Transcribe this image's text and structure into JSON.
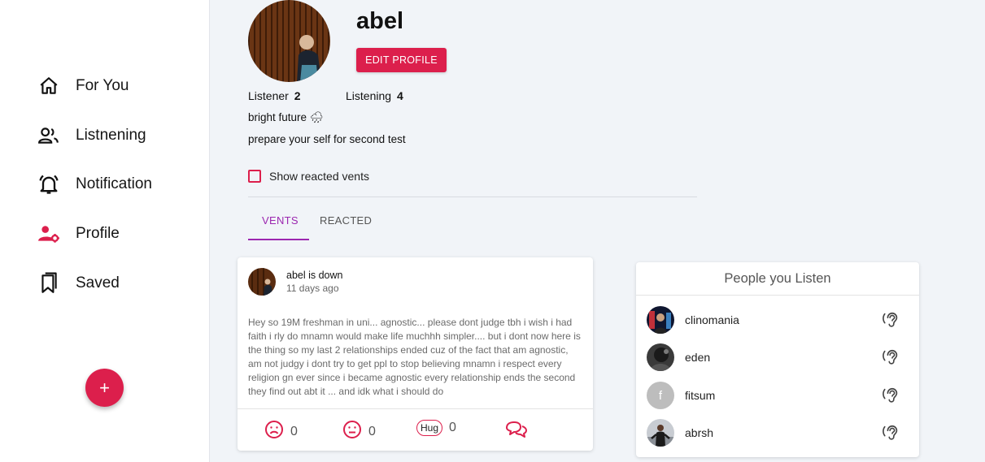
{
  "sidebar": {
    "items": [
      {
        "label": "For You",
        "icon": "home-icon"
      },
      {
        "label": "Listnening",
        "icon": "people-icon"
      },
      {
        "label": "Notification",
        "icon": "bell-icon"
      },
      {
        "label": "Profile",
        "icon": "profile-settings-icon"
      },
      {
        "label": "Saved",
        "icon": "bookmark-icon"
      }
    ],
    "fab_label": "+"
  },
  "profile": {
    "username": "abel",
    "edit_label": "EDIT PROFILE",
    "listener_label": "Listener",
    "listener_count": "2",
    "listening_label": "Listening",
    "listening_count": "4",
    "bio_line1": "bright future 🌧",
    "bio_line2": "prepare your self for second test",
    "show_reacted_label": "Show reacted vents"
  },
  "tabs": [
    {
      "label": "VENTS",
      "active": true
    },
    {
      "label": "REACTED",
      "active": false
    }
  ],
  "vent": {
    "title": "abel is down",
    "time": "11 days ago",
    "body": "Hey so 19M freshman in uni... agnostic... please dont judge tbh i wish i had faith i rly do mnamn would make life muchhh simpler.... but i dont now here is the thing so my last 2 relationships ended cuz of the fact that am agnostic, am not judgy i dont try to get ppl to stop believing mnamn i respect every religion gn ever since i became agnostic every relationship ends the second they find out abt it ... and idk what i should do",
    "reactions": {
      "sad_count": "0",
      "smile_count": "0",
      "hug_label": "Hug",
      "hug_count": "0"
    }
  },
  "listen_panel": {
    "title": "People you Listen",
    "people": [
      {
        "name": "clinomania"
      },
      {
        "name": "eden"
      },
      {
        "name": "fitsum",
        "initial": "f"
      },
      {
        "name": "abrsh"
      }
    ]
  },
  "colors": {
    "accent": "#dc1f4c",
    "tab_active": "#9c27b0",
    "background": "#f1f4f8"
  }
}
